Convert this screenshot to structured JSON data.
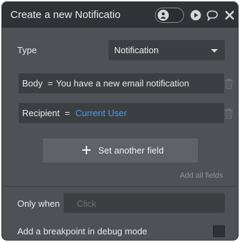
{
  "header": {
    "title": "Create a new Notification",
    "icons": [
      "user-toggle-icon",
      "play-icon",
      "comment-icon",
      "close-icon"
    ]
  },
  "type_row": {
    "label": "Type",
    "selected": "Notification"
  },
  "fields": [
    {
      "key": "Body",
      "equals": "=",
      "value": "You have a new email notification",
      "value_color": "#e8e9ea"
    },
    {
      "key": "Recipient",
      "equals": "=",
      "value": "Current User",
      "value_color": "#4a9be8"
    }
  ],
  "set_field_button": "Set another field",
  "add_all_link": "Add all fields",
  "only_when": {
    "label": "Only when",
    "placeholder": "Click"
  },
  "breakpoint": {
    "label": "Add a breakpoint in debug mode",
    "checked": false
  }
}
